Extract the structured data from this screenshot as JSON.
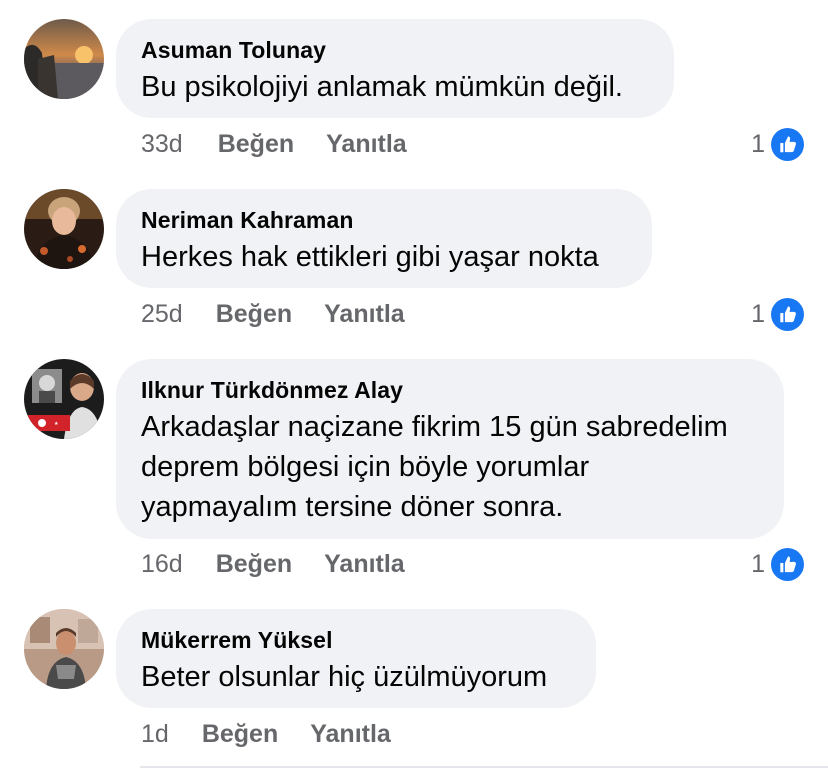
{
  "comments": [
    {
      "author": "Asuman Tolunay",
      "text_lines": [
        "Bu psikolojiyi anlamak mümkün değil."
      ],
      "time": "33d",
      "like_label": "Beğen",
      "reply_label": "Yanıtla",
      "reaction_count": "1",
      "reaction_icon": "like-icon",
      "avatar": "sunset-avatar"
    },
    {
      "author": "Neriman Kahraman",
      "text_lines": [
        "Herkes hak ettikleri gibi yaşar nokta"
      ],
      "time": "25d",
      "like_label": "Beğen",
      "reply_label": "Yanıtla",
      "reaction_count": "1",
      "reaction_icon": "like-icon",
      "avatar": "woman-avatar"
    },
    {
      "author": "Ilknur Türkdönmez Alay",
      "text_lines": [
        "Arkadaşlar naçizane fikrim 15 gün sabredelim",
        "deprem bölgesi için böyle yorumlar",
        "yapmayalım tersine döner sonra."
      ],
      "time": "16d",
      "like_label": "Beğen",
      "reply_label": "Yanıtla",
      "reaction_count": "1",
      "reaction_icon": "like-icon",
      "avatar": "flag-avatar"
    },
    {
      "author": "Mükerrem Yüksel",
      "text_lines": [
        "Beter olsunlar hiç üzülmüyorum"
      ],
      "time": "1d",
      "like_label": "Beğen",
      "reply_label": "Yanıtla",
      "avatar": "woman-room-avatar"
    }
  ],
  "colors": {
    "bubble_bg": "#f0f2f5",
    "secondary_text": "#65676b",
    "like_blue": "#1877f2"
  }
}
